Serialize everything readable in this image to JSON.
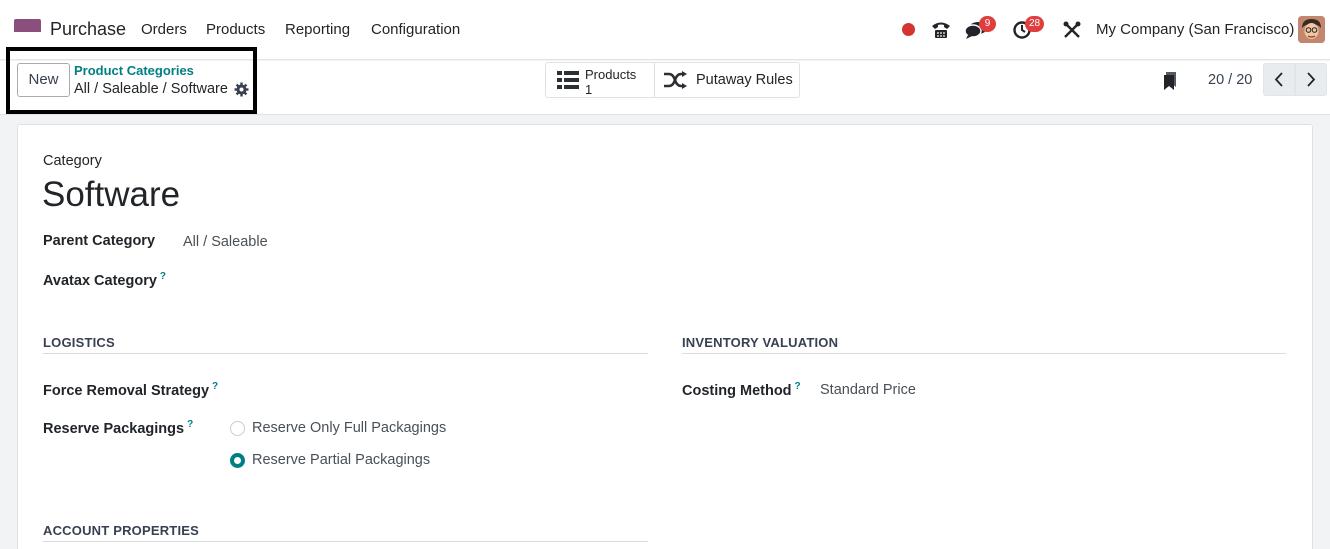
{
  "topnav": {
    "app_name": "Purchase",
    "menu": [
      "Orders",
      "Products",
      "Reporting",
      "Configuration"
    ],
    "messages_count": "9",
    "activities_count": "28",
    "company": "My Company (San Francisco)",
    "icons": [
      "recording-dot-icon",
      "phone-icon",
      "chat-icon",
      "activity-clock-icon",
      "tools-icon"
    ],
    "colors": {
      "accent": "#017e84",
      "badge": "#e03e3e",
      "app_icon_top": "#1a9d9a",
      "app_icon_bottom": "#8a4f7d"
    }
  },
  "control_panel": {
    "new_label": "New",
    "breadcrumb_parent": "Product Categories",
    "breadcrumb_current": "All / Saleable / Software",
    "smart_buttons": {
      "products_label": "Products",
      "products_count": "1",
      "putaway_label": "Putaway Rules"
    },
    "pager": "20 / 20"
  },
  "form": {
    "category_label": "Category",
    "category_name": "Software",
    "parent_category_label": "Parent Category",
    "parent_category_value": "All / Saleable",
    "avatax_label": "Avatax Category",
    "help_mark": "?",
    "logistics": {
      "title": "LOGISTICS",
      "removal_strategy_label": "Force Removal Strategy",
      "reserve_packagings_label": "Reserve Packagings",
      "options": [
        "Reserve Only Full Packagings",
        "Reserve Partial Packagings"
      ],
      "selected_option": "Reserve Partial Packagings"
    },
    "inventory_valuation": {
      "title": "INVENTORY VALUATION",
      "costing_method_label": "Costing Method",
      "costing_method_value": "Standard Price"
    },
    "account_properties": {
      "title": "ACCOUNT PROPERTIES"
    }
  }
}
